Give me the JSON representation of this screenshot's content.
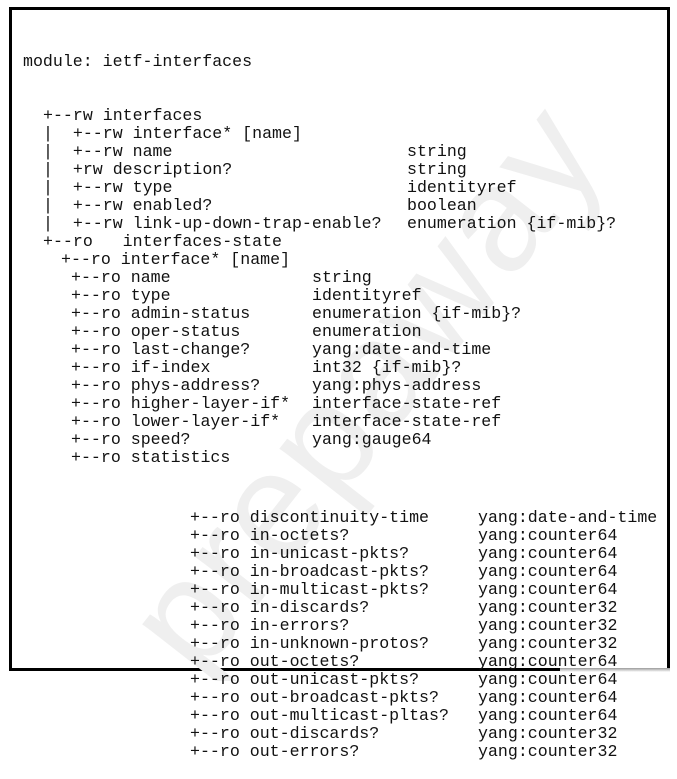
{
  "watermark": "prepaway",
  "module_header": "module: ietf-interfaces",
  "lines": [
    {
      "indent": 2,
      "node": "+--rw interfaces",
      "type": ""
    },
    {
      "indent": 2,
      "node": "|  +--rw interface* [name]",
      "type": ""
    },
    {
      "indent": 2,
      "node": "|  +--rw name",
      "type": "string"
    },
    {
      "indent": 2,
      "node": "|  +rw description?",
      "type": "string"
    },
    {
      "indent": 2,
      "node": "|  +--rw type",
      "type": "identityref"
    },
    {
      "indent": 2,
      "node": "|  +--rw enabled?",
      "type": "boolean"
    },
    {
      "indent": 2,
      "node": "|  +--rw link-up-down-trap-enable?",
      "type": "enumeration {if-mib}?"
    },
    {
      "indent": 2,
      "node": "+--ro   interfaces-state",
      "type": ""
    },
    {
      "indent": 4,
      "node": "+--ro interface* [name]",
      "type": ""
    },
    {
      "indent": 5,
      "node": "+--ro name",
      "type": "string"
    },
    {
      "indent": 5,
      "node": "+--ro type",
      "type": "identityref"
    },
    {
      "indent": 5,
      "node": "+--ro admin-status",
      "type": "enumeration {if-mib}?"
    },
    {
      "indent": 5,
      "node": "+--ro oper-status",
      "type": "enumeration"
    },
    {
      "indent": 5,
      "node": "+--ro last-change?",
      "type": "yang:date-and-time"
    },
    {
      "indent": 5,
      "node": "+--ro if-index",
      "type": "int32 {if-mib}?"
    },
    {
      "indent": 5,
      "node": "+--ro phys-address?",
      "type": "yang:phys-address"
    },
    {
      "indent": 5,
      "node": "+--ro higher-layer-if*",
      "type": "interface-state-ref"
    },
    {
      "indent": 5,
      "node": "+--ro lower-layer-if*",
      "type": "interface-state-ref"
    },
    {
      "indent": 5,
      "node": "+--ro speed?",
      "type": "yang:gauge64"
    },
    {
      "indent": 5,
      "node": "+--ro statistics",
      "type": ""
    }
  ],
  "statistics": [
    {
      "node": "+--ro discontinuity-time",
      "type": "yang:date-and-time"
    },
    {
      "node": "+--ro in-octets?",
      "type": "yang:counter64"
    },
    {
      "node": "+--ro in-unicast-pkts?",
      "type": "yang:counter64"
    },
    {
      "node": "+--ro in-broadcast-pkts?",
      "type": "yang:counter64"
    },
    {
      "node": "+--ro in-multicast-pkts?",
      "type": "yang:counter64"
    },
    {
      "node": "+--ro in-discards?",
      "type": "yang:counter32"
    },
    {
      "node": "+--ro in-errors?",
      "type": "yang:counter32"
    },
    {
      "node": "+--ro in-unknown-protos?",
      "type": "yang:counter32"
    },
    {
      "node": "+--ro out-octets?",
      "type": "yang:counter64"
    },
    {
      "node": "+--ro out-unicast-pkts?",
      "type": "yang:counter64"
    },
    {
      "node": "+--ro out-broadcast-pkts?",
      "type": "yang:counter64"
    },
    {
      "node": "+--ro out-multicast-pltas?",
      "type": "yang:counter64"
    },
    {
      "node": "+--ro out-discards?",
      "type": "yang:counter32"
    },
    {
      "node": "+--ro out-errors?",
      "type": "yang:counter32"
    }
  ]
}
